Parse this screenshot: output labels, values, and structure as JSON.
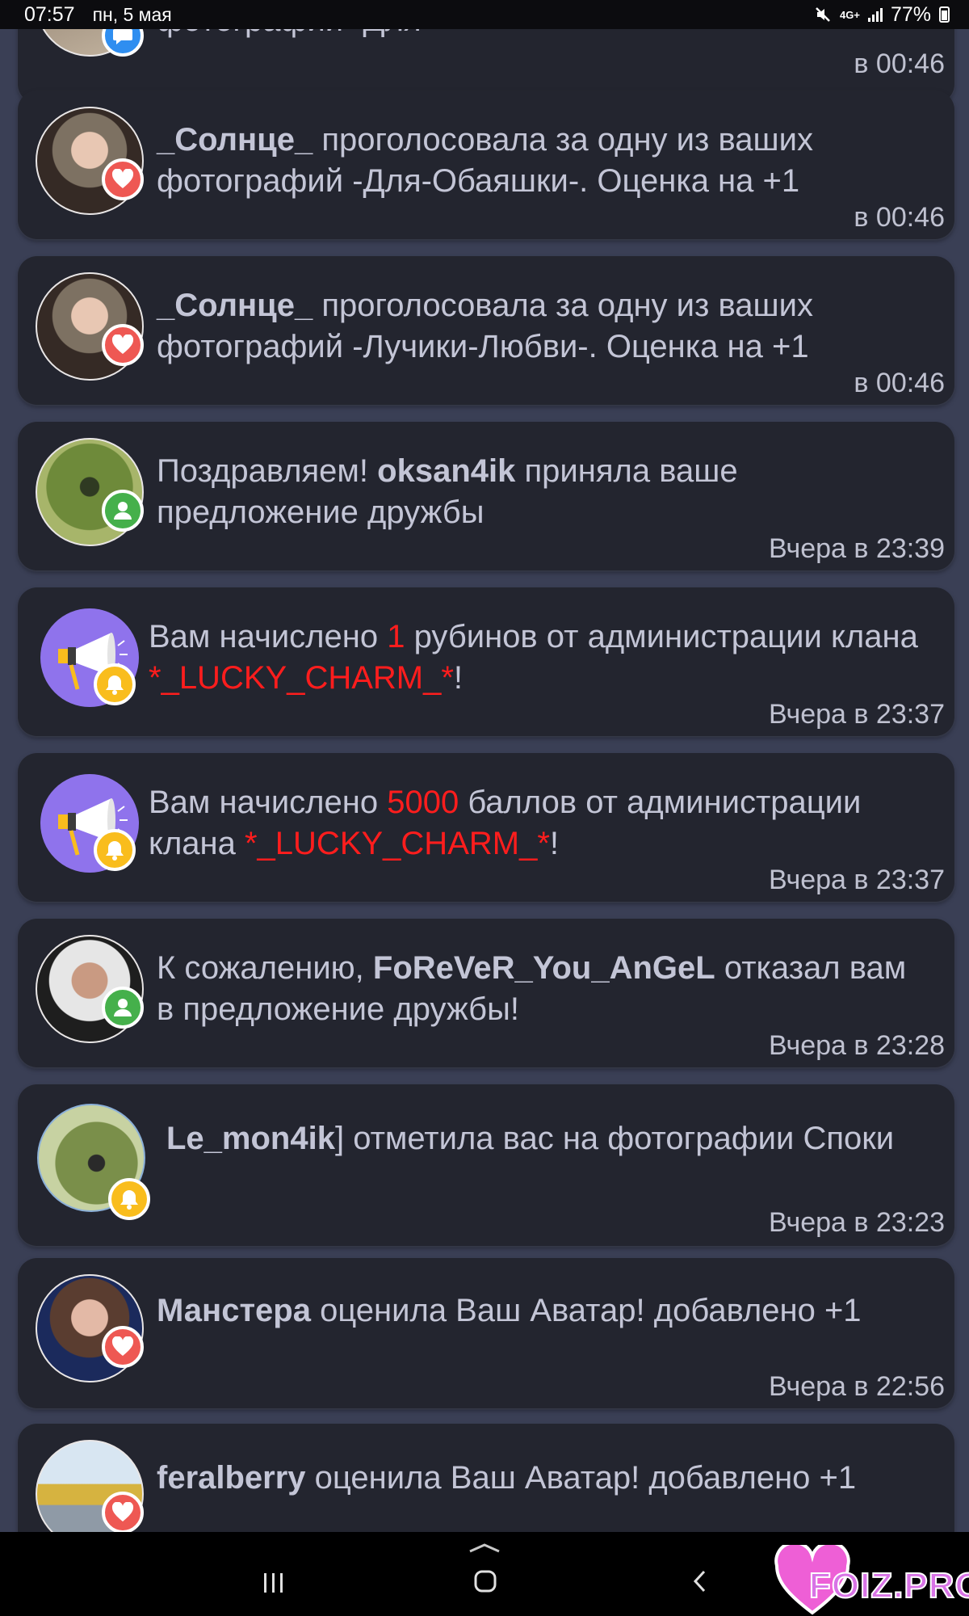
{
  "status_bar": {
    "time": "07:57",
    "date": "пн, 5 мая",
    "network": "4G+",
    "battery": "77%"
  },
  "notifications": [
    {
      "badge_icon": "chat-bubble-icon",
      "parts": [],
      "time": "в 00:46"
    },
    {
      "badge_icon": "heart-icon",
      "parts": [
        {
          "t": "_Солнце_",
          "s": "bold"
        },
        {
          "t": " проголосовала за одну из ваших фотографий -Для-Обаяшки-. Оценка на +1",
          "s": "normal"
        }
      ],
      "time": "в 00:46"
    },
    {
      "badge_icon": "heart-icon",
      "parts": [
        {
          "t": "_Солнце_",
          "s": "bold"
        },
        {
          "t": " проголосовала за одну из ваших фотографий -Лучики-Любви-. Оценка на +1",
          "s": "normal"
        }
      ],
      "time": "в 00:46"
    },
    {
      "badge_icon": "user-icon",
      "parts": [
        {
          "t": "Поздравляем! ",
          "s": "normal"
        },
        {
          "t": "oksan4ik",
          "s": "bold"
        },
        {
          "t": " приняла ваше предложение дружбы",
          "s": "normal"
        }
      ],
      "time": "Вчера в 23:39"
    },
    {
      "badge_icon": "bell-icon",
      "parts": [
        {
          "t": "Вам начислено ",
          "s": "normal"
        },
        {
          "t": "1",
          "s": "red"
        },
        {
          "t": " рубинов от администрации клана ",
          "s": "normal"
        },
        {
          "t": "*_LUCKY_CHARM_*",
          "s": "red"
        },
        {
          "t": "!",
          "s": "normal"
        }
      ],
      "time": "Вчера в 23:37"
    },
    {
      "badge_icon": "bell-icon",
      "parts": [
        {
          "t": "Вам начислено ",
          "s": "normal"
        },
        {
          "t": "5000",
          "s": "red"
        },
        {
          "t": " баллов от администрации клана ",
          "s": "normal"
        },
        {
          "t": "*_LUCKY_CHARM_*",
          "s": "red"
        },
        {
          "t": "!",
          "s": "normal"
        }
      ],
      "time": "Вчера в 23:37"
    },
    {
      "badge_icon": "user-icon",
      "parts": [
        {
          "t": "К сожалению, ",
          "s": "normal"
        },
        {
          "t": "FoReVeR_You_AnGeL",
          "s": "bold"
        },
        {
          "t": " отказал вам в предложение дружбы!",
          "s": "normal"
        }
      ],
      "time": "Вчера в 23:28"
    },
    {
      "badge_icon": "bell-icon",
      "parts": [
        {
          "t": "Le_mon4ik",
          "s": "bold"
        },
        {
          "t": "] отметила вас на фотографии Споки",
          "s": "normal"
        }
      ],
      "time": "Вчера в 23:23"
    },
    {
      "badge_icon": "heart-icon",
      "parts": [
        {
          "t": "Манстера",
          "s": "bold"
        },
        {
          "t": " оценила Ваш Аватар! добавлено +1",
          "s": "normal"
        }
      ],
      "time": "Вчера в 22:56"
    },
    {
      "badge_icon": "heart-icon",
      "parts": [
        {
          "t": "feralberry",
          "s": "bold"
        },
        {
          "t": " оценила Ваш Аватар! добавлено +1",
          "s": "normal"
        }
      ],
      "time": ""
    }
  ],
  "watermark": {
    "text": "FOIZ.PRO"
  },
  "colors": {
    "card_bg": "#23252f",
    "page_bg": "#3a3f55",
    "text": "#c3c5d6",
    "highlight_red": "#ff1d1d",
    "heart_badge": "#ee5853",
    "friend_badge": "#45b04b",
    "bell_badge": "#f9bd1d",
    "chat_badge": "#2f8ef0",
    "megaphone_avatar": "#8f73ec"
  }
}
